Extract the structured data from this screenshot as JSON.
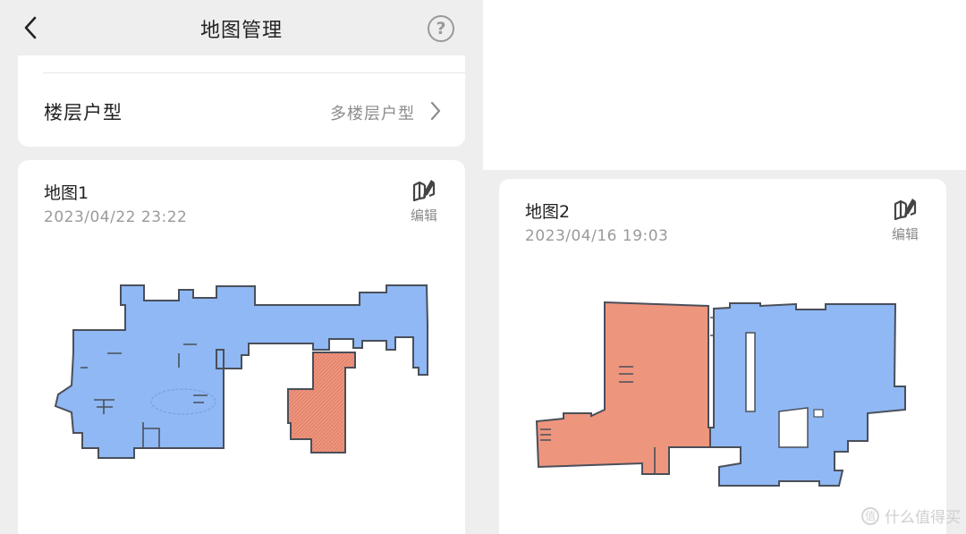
{
  "header": {
    "title": "地图管理"
  },
  "settings": {
    "floor_label": "楼层户型",
    "floor_value": "多楼层户型"
  },
  "maps": [
    {
      "name": "地图1",
      "date": "2023/04/22 23:22",
      "edit_label": "编辑"
    },
    {
      "name": "地图2",
      "date": "2023/04/16 19:03",
      "edit_label": "编辑"
    }
  ],
  "watermark": {
    "text": "什么值得买",
    "icon_text": "值"
  },
  "colors": {
    "room_blue": "#8fb8f4",
    "room_orange": "#ee957e",
    "room_outline": "#4a4f59"
  },
  "icons": [
    "back-arrow-icon",
    "help-icon",
    "chevron-right-icon",
    "map-edit-icon"
  ]
}
